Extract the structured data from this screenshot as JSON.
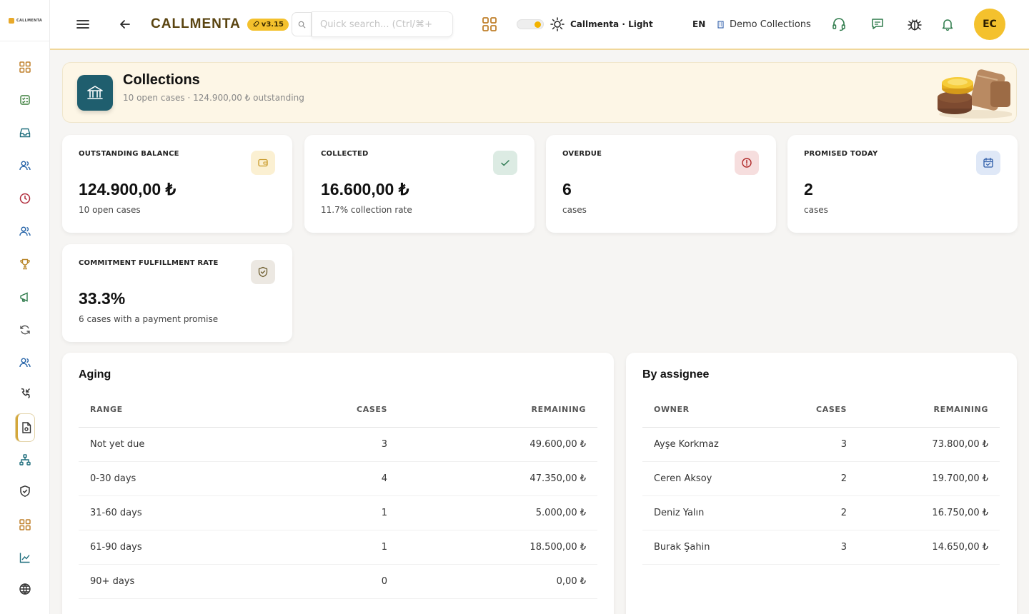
{
  "sidebar": {
    "logo_text": "CALLMENTA",
    "items": [
      {
        "icon": "grid-icon",
        "color": "#c0812d"
      },
      {
        "icon": "task-check-icon",
        "color": "#3a7d3a"
      },
      {
        "icon": "inbox-icon",
        "color": "#1f6e7d"
      },
      {
        "icon": "users-icon",
        "color": "#2563a8"
      },
      {
        "icon": "clock-icon",
        "color": "#b02a3a"
      },
      {
        "icon": "users-icon",
        "color": "#2563a8"
      },
      {
        "icon": "trophy-icon",
        "color": "#b8862a"
      },
      {
        "icon": "megaphone-icon",
        "color": "#2d7a4a"
      },
      {
        "icon": "sync-icon",
        "color": "#555555"
      },
      {
        "icon": "users-icon",
        "color": "#2563a8"
      },
      {
        "icon": "phone-incoming-icon",
        "color": "#333333"
      },
      {
        "icon": "invoice-icon",
        "color": "#333333"
      },
      {
        "icon": "org-tree-icon",
        "color": "#1f6e7d"
      },
      {
        "icon": "shield-icon",
        "color": "#333333"
      },
      {
        "icon": "grid-icon",
        "color": "#c0812d"
      },
      {
        "icon": "chart-line-icon",
        "color": "#1f6e7d"
      },
      {
        "icon": "globe-icon",
        "color": "#333333"
      }
    ]
  },
  "topbar": {
    "brand": "CALLMENTA",
    "version": "v3.15",
    "search_placeholder": "Quick search... (Ctrl/⌘+",
    "theme_label": "Callmenta · Light",
    "language": "EN",
    "organization": "Demo Collections",
    "avatar_initials": "EC"
  },
  "header": {
    "title": "Collections",
    "subtitle": "10 open cases · 124.900,00 ₺ outstanding"
  },
  "kpis": [
    {
      "label": "OUTSTANDING BALANCE",
      "value": "124.900,00 ₺",
      "sub": "10 open cases",
      "icon": "wallet-icon",
      "icon_bg": "#fbf0d2",
      "icon_color": "#c99a2a"
    },
    {
      "label": "COLLECTED",
      "value": "16.600,00 ₺",
      "sub": "11.7% collection rate",
      "icon": "check-icon",
      "icon_bg": "#dcebe3",
      "icon_color": "#2e7a52"
    },
    {
      "label": "OVERDUE",
      "value": "6",
      "sub": "cases",
      "icon": "alert-circle-icon",
      "icon_bg": "#f6dede",
      "icon_color": "#b02a2a"
    },
    {
      "label": "PROMISED TODAY",
      "value": "2",
      "sub": "cases",
      "icon": "calendar-check-icon",
      "icon_bg": "#dfe8f7",
      "icon_color": "#2d5ca8"
    },
    {
      "label": "COMMITMENT FULFILLMENT RATE",
      "value": "33.3%",
      "sub": "6 cases with a payment promise",
      "icon": "shield-check-icon",
      "icon_bg": "#ece8e2",
      "icon_color": "#6b5a2a"
    }
  ],
  "aging": {
    "title": "Aging",
    "columns": [
      "RANGE",
      "CASES",
      "REMAINING"
    ],
    "rows": [
      [
        "Not yet due",
        "3",
        "49.600,00 ₺"
      ],
      [
        "0-30 days",
        "4",
        "47.350,00 ₺"
      ],
      [
        "31-60 days",
        "1",
        "5.000,00 ₺"
      ],
      [
        "61-90 days",
        "1",
        "18.500,00 ₺"
      ],
      [
        "90+ days",
        "0",
        "0,00 ₺"
      ]
    ]
  },
  "assignee": {
    "title": "By assignee",
    "columns": [
      "OWNER",
      "CASES",
      "REMAINING"
    ],
    "rows": [
      [
        "Ayşe Korkmaz",
        "3",
        "73.800,00 ₺"
      ],
      [
        "Ceren Aksoy",
        "2",
        "19.700,00 ₺"
      ],
      [
        "Deniz Yalın",
        "2",
        "16.750,00 ₺"
      ],
      [
        "Burak Şahin",
        "3",
        "14.650,00 ₺"
      ]
    ]
  }
}
